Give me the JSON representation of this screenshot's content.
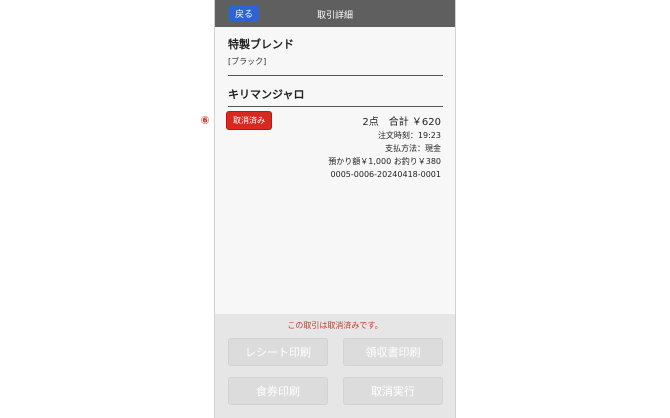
{
  "header": {
    "back_label": "戻る",
    "title": "取引詳細"
  },
  "items": [
    {
      "name": "特製ブレンド",
      "option": "[ブラック]"
    },
    {
      "name": "キリマンジャロ"
    }
  ],
  "annotation": {
    "number": "⑥"
  },
  "status_badge": "取消済み",
  "summary": {
    "line": "2点　合計 ￥620",
    "order_time": "注文時刻：19:23",
    "payment_method": "支払方法：現金",
    "cash": "預かり額￥1,000 お釣り￥380",
    "transaction_id": "0005-0006-20240418-0001"
  },
  "footer": {
    "notice": "この取引は取消済みです。",
    "buttons": {
      "receipt_print": "レシート印刷",
      "invoice_print": "領収書印刷",
      "ticket_print": "食券印刷",
      "cancel_execute": "取消実行"
    }
  },
  "colors": {
    "header_bg": "#5f5f5f",
    "back_button": "#2c64d8",
    "cancel_badge": "#d8281f",
    "notice_text": "#c0392b",
    "disabled_button": "#dcdcdc"
  }
}
